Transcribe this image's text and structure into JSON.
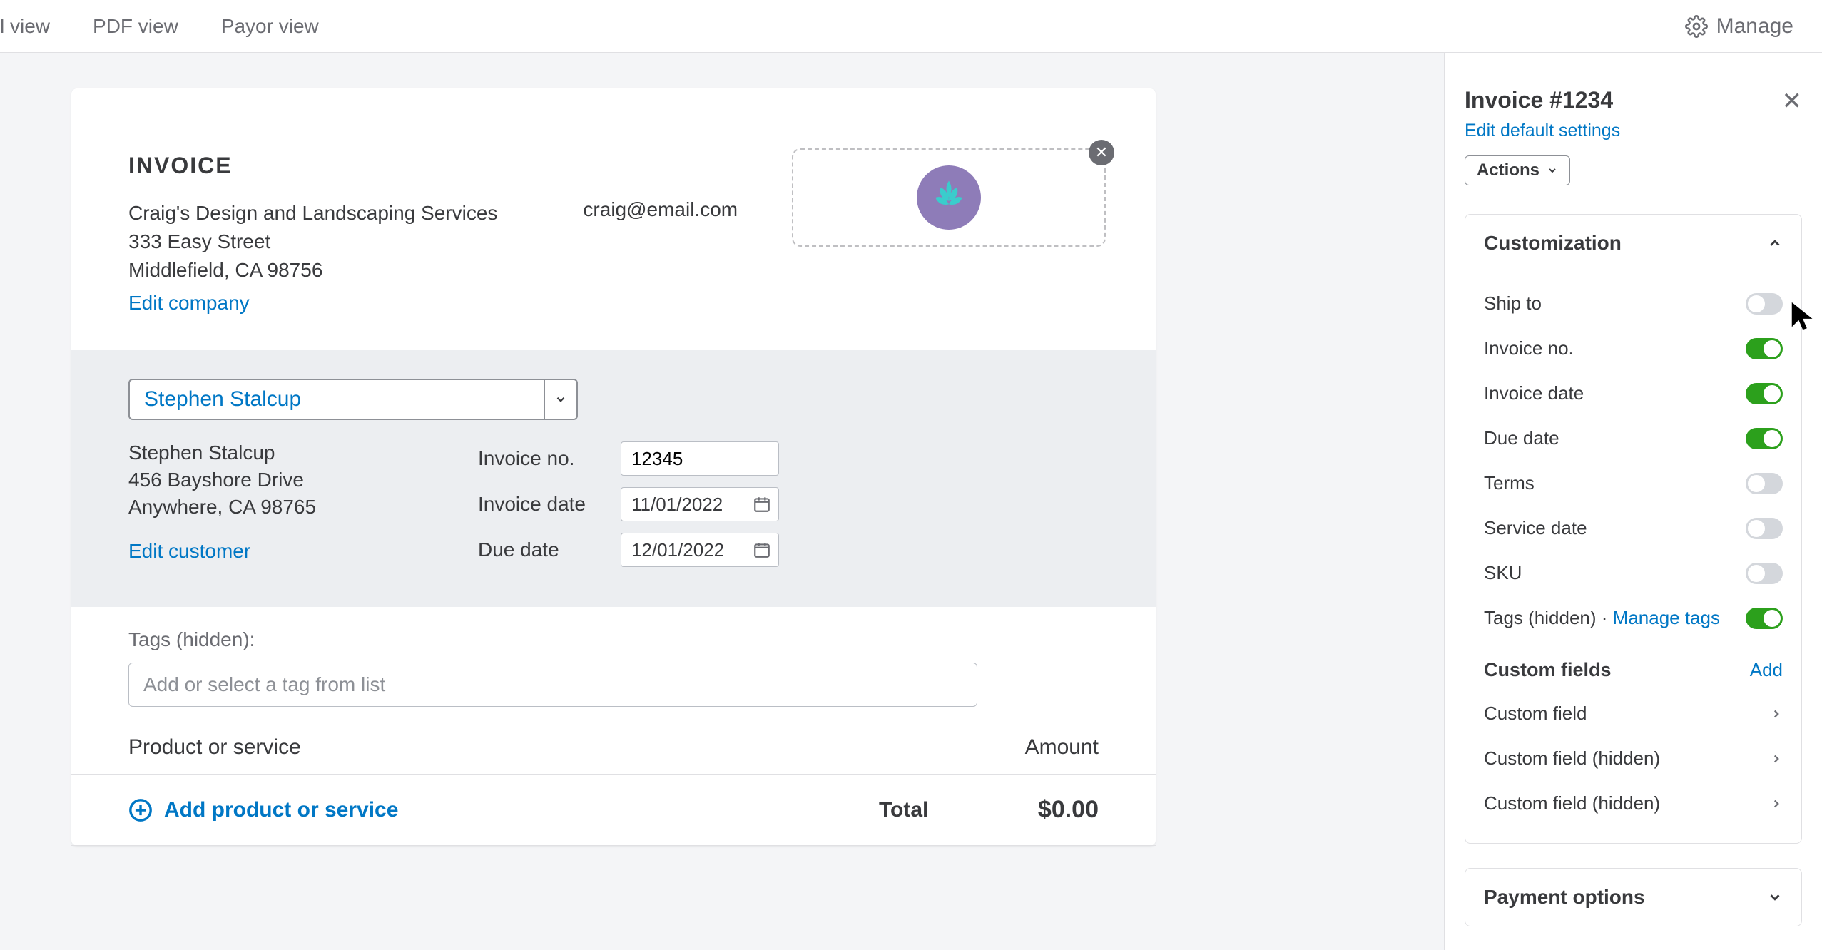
{
  "topbar": {
    "tabs": [
      "l view",
      "PDF view",
      "Payor view"
    ],
    "manage_label": "Manage"
  },
  "invoice": {
    "title": "INVOICE",
    "company_name": "Craig's Design and Landscaping Services",
    "company_street": "333 Easy Street",
    "company_citystate": "Middlefield, CA 98756",
    "company_email": "craig@email.com",
    "edit_company_label": "Edit company"
  },
  "customer": {
    "selected": "Stephen Stalcup",
    "name": "Stephen Stalcup",
    "street": "456 Bayshore Drive",
    "citystate": "Anywhere, CA 98765",
    "edit_customer_label": "Edit customer"
  },
  "meta": {
    "invoice_no_label": "Invoice no.",
    "invoice_no_value": "12345",
    "invoice_date_label": "Invoice date",
    "invoice_date_value": "11/01/2022",
    "due_date_label": "Due date",
    "due_date_value": "12/01/2022"
  },
  "tags": {
    "label": "Tags (hidden):",
    "placeholder": "Add or select a tag from list"
  },
  "lines": {
    "product_header": "Product or service",
    "amount_header": "Amount",
    "add_label": "Add product or service",
    "total_label": "Total",
    "total_value": "$0.00"
  },
  "panel": {
    "title": "Invoice #1234",
    "edit_defaults_label": "Edit default settings",
    "actions_label": "Actions",
    "customization_title": "Customization",
    "toggles": [
      {
        "label": "Ship to",
        "on": false
      },
      {
        "label": "Invoice no.",
        "on": true
      },
      {
        "label": "Invoice date",
        "on": true
      },
      {
        "label": "Due date",
        "on": true
      },
      {
        "label": "Terms",
        "on": false
      },
      {
        "label": "Service date",
        "on": false
      },
      {
        "label": "SKU",
        "on": false
      }
    ],
    "tags_toggle_label": "Tags (hidden)",
    "tags_toggle_on": true,
    "manage_tags_label": "Manage tags",
    "custom_fields_title": "Custom fields",
    "custom_fields_add_label": "Add",
    "custom_fields": [
      "Custom field",
      "Custom field (hidden)",
      "Custom field (hidden)"
    ],
    "payment_options_title": "Payment options"
  }
}
